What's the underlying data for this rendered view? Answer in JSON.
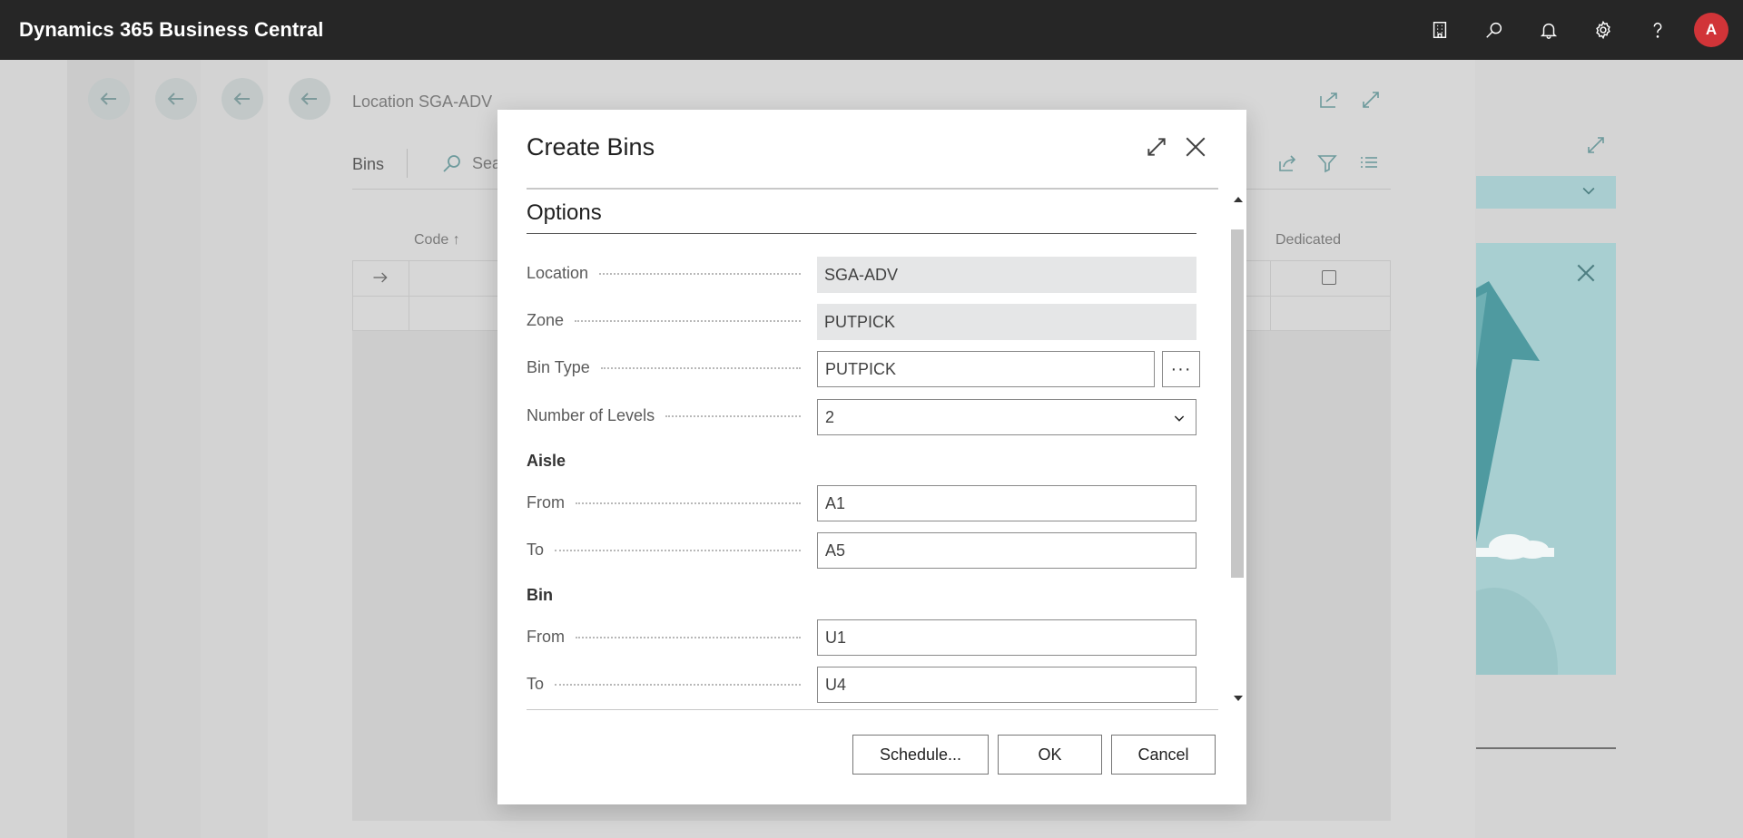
{
  "app": {
    "title": "Dynamics 365 Business Central",
    "avatar_initial": "A"
  },
  "topbar": {
    "icons": [
      "company-icon",
      "search-icon",
      "bell-icon",
      "gear-icon",
      "help-icon"
    ]
  },
  "background_page": {
    "breadcrumb": "Location SGA-ADV",
    "bins_label": "Bins",
    "search_label": "Sea",
    "columns": [
      "Code ↑",
      "Dedicated"
    ]
  },
  "dialog": {
    "title": "Create Bins",
    "section": "Options",
    "fields": {
      "location": {
        "label": "Location",
        "value": "SGA-ADV"
      },
      "zone": {
        "label": "Zone",
        "value": "PUTPICK"
      },
      "bin_type": {
        "label": "Bin Type",
        "value": "PUTPICK",
        "lookup": "···"
      },
      "levels": {
        "label": "Number of Levels",
        "value": "2"
      }
    },
    "aisle": {
      "title": "Aisle",
      "from": {
        "label": "From",
        "value": "A1"
      },
      "to": {
        "label": "To",
        "value": "A5"
      }
    },
    "bin": {
      "title": "Bin",
      "from": {
        "label": "From",
        "value": "U1"
      },
      "to": {
        "label": "To",
        "value": "U4"
      }
    },
    "buttons": {
      "schedule": "Schedule...",
      "ok": "OK",
      "cancel": "Cancel"
    }
  }
}
